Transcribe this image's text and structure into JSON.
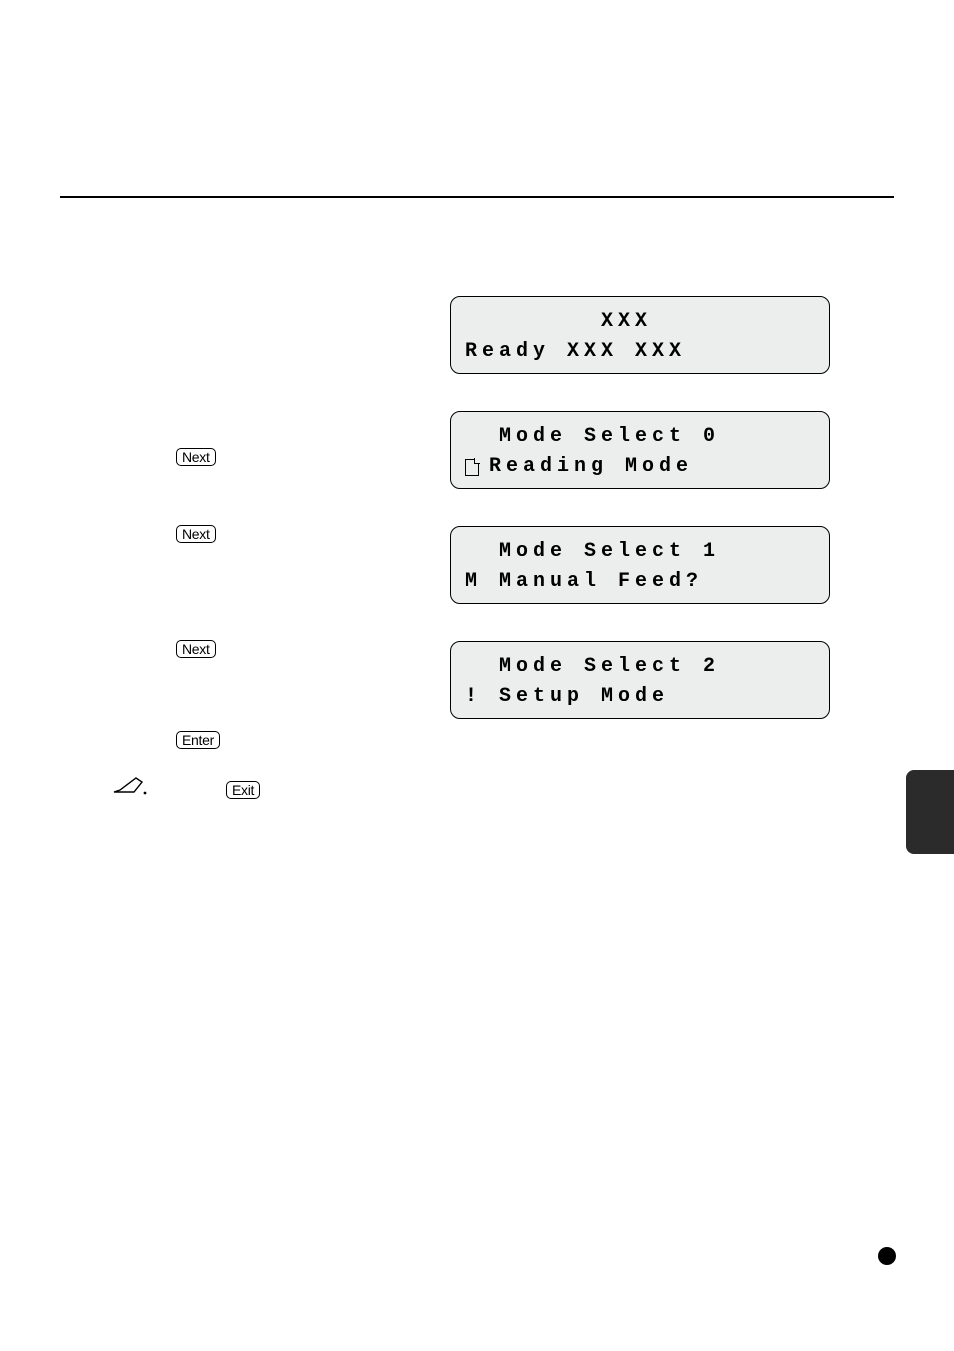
{
  "keys": {
    "next": "Next",
    "enter": "Enter",
    "exit": "Exit"
  },
  "lcd_ready": {
    "line1": "        XXX",
    "line2": "Ready XXX XXX"
  },
  "lcd_mode0": {
    "line1": "  Mode Select 0",
    "line2": "Reading Mode"
  },
  "lcd_mode1": {
    "line1": "  Mode Select 1",
    "line2": "M Manual Feed?"
  },
  "lcd_mode2": {
    "line1": "  Mode Select 2",
    "line2": "! Setup Mode"
  }
}
